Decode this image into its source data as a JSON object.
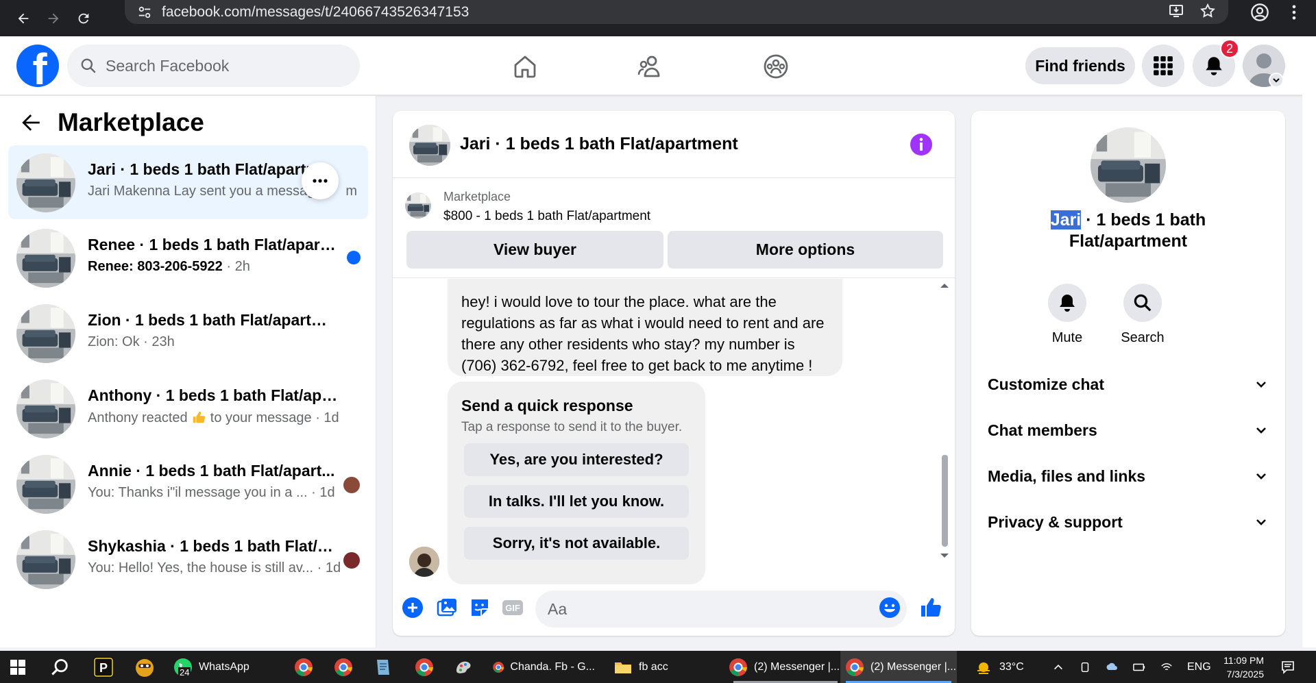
{
  "browser": {
    "url": "facebook.com/messages/t/24066743526347153"
  },
  "topbar": {
    "search_placeholder": "Search Facebook",
    "find_friends": "Find friends",
    "notification_count": "2",
    "brand_color": "#0866ff"
  },
  "left": {
    "title": "Marketplace",
    "conversations": [
      {
        "title": "Jari · 1 beds 1 bath Flat/apartment",
        "preview": "Jari Makenna Lay sent you a message",
        "preview_tail": "m",
        "time": "",
        "unread": false,
        "active": true
      },
      {
        "title": "Renee · 1 beds 1 bath Flat/apart...",
        "preview": "Renee: 803-206-5922",
        "time": "2h",
        "unread": true
      },
      {
        "title": "Zion · 1 beds 1 bath Flat/apartment",
        "preview": "Zion: Ok",
        "time": "23h",
        "unread": false
      },
      {
        "title": "Anthony · 1 beds 1 bath Flat/apart...",
        "preview": "Anthony reacted",
        "preview_after": "to your message",
        "time": "1d",
        "unread": false
      },
      {
        "title": "Annie · 1 beds 1 bath Flat/apart...",
        "preview": "You: Thanks i\"il message you in a ...",
        "time": "1d",
        "unread": false
      },
      {
        "title": "Shykashia · 1 beds 1 bath Flat/ap...",
        "preview": "You: Hello! Yes, the house is still av...",
        "time": "1d",
        "unread": false
      }
    ]
  },
  "chat": {
    "name": "Jari · 1 beds 1 bath Flat/apartment",
    "listing_kicker": "Marketplace",
    "listing_price": "$800 - 1 beds 1 bath Flat/apartment",
    "view_buyer": "View buyer",
    "more_options": "More options",
    "message": "hey! i would love to tour the place. what are the regulations as far as what i would need to rent and are there any other residents who stay? my number is (706) 362-6792, feel free to get back to me anytime !",
    "quick_title": "Send a quick response",
    "quick_sub": "Tap a response to send it to the buyer.",
    "quick_replies": [
      "Yes, are you interested?",
      "In talks. I'll let you know.",
      "Sorry, it's not available."
    ],
    "composer_placeholder": "Aa",
    "accent": "#a033ff"
  },
  "rpanel": {
    "name_selected": "Jari",
    "name_line1_rest": " · 1 beds 1 bath",
    "name_line2": "Flat/apartment",
    "mute": "Mute",
    "search": "Search",
    "sections": [
      "Customize chat",
      "Chat members",
      "Media, files and links",
      "Privacy & support"
    ]
  },
  "taskbar": {
    "whatsapp": "WhatsApp",
    "whatsapp_badge": "24",
    "chanda": "Chanda. Fb - G...",
    "fbacc": "fb acc",
    "messenger1": "(2) Messenger |...",
    "messenger2": "(2) Messenger |...",
    "weather": "33°C",
    "lang": "ENG",
    "time": "11:09 PM",
    "date": "7/3/2025"
  }
}
